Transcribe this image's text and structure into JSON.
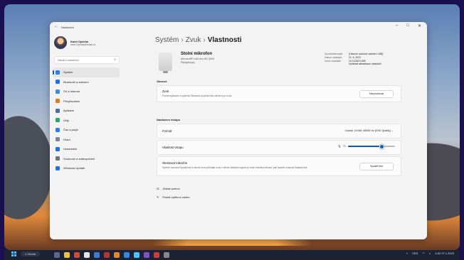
{
  "window": {
    "title": "Nastavení"
  },
  "user": {
    "name": "Karel Operka",
    "email": "karel.Operka@email.cz"
  },
  "search": {
    "placeholder": "Hledat v nastavení"
  },
  "nav": [
    {
      "label": "Systém",
      "icon": "monitor-icon",
      "color": "#2b7de9",
      "active": true
    },
    {
      "label": "Bluetooth a zařízení",
      "icon": "bluetooth-icon",
      "color": "#1a73e8"
    },
    {
      "label": "Síť a internet",
      "icon": "wifi-icon",
      "color": "#3a8ddb"
    },
    {
      "label": "Přizpůsobení",
      "icon": "brush-icon",
      "color": "#e07b1a"
    },
    {
      "label": "Aplikace",
      "icon": "apps-icon",
      "color": "#4a6fa5"
    },
    {
      "label": "Účty",
      "icon": "account-icon",
      "color": "#2aa36b"
    },
    {
      "label": "Čas a jazyk",
      "icon": "globe-icon",
      "color": "#2b7de9"
    },
    {
      "label": "Hraní",
      "icon": "gamepad-icon",
      "color": "#7b8794"
    },
    {
      "label": "Usnadnění",
      "icon": "accessibility-icon",
      "color": "#1a73e8"
    },
    {
      "label": "Soukromí a zabezpečení",
      "icon": "shield-icon",
      "color": "#6b7280"
    },
    {
      "label": "Windows Update",
      "icon": "update-icon",
      "color": "#1a73e8"
    }
  ],
  "breadcrumb": {
    "part1": "Systém",
    "part2": "Zvuk",
    "current": "Vlastnosti",
    "sep": "›"
  },
  "device": {
    "name": "Stolní mikrofon",
    "model": "Microsoft® LifeCam HD-3000",
    "status": "Připojeno(a)"
  },
  "properties": [
    {
      "k": "Zprostředkovatel",
      "v": "(Obecné zvukové zařízení USB)"
    },
    {
      "k": "Datum ovladače",
      "v": "21. 6. 2022"
    },
    {
      "k": "Verze ovladače",
      "v": "10.0.22621.608"
    },
    {
      "k": "",
      "v": "Vyhledat aktualizace ovladačů"
    }
  ],
  "general": {
    "section": "Obecné",
    "title": "Zvuk",
    "desc": "Povolit aplikacím a systému Windows používat toto zařízení pro zvuk",
    "button": "Nepovolovat"
  },
  "input": {
    "section": "Nastavení vstupu",
    "format_label": "Formát",
    "format_value": "1 kanál, 16 bitů, 48000 Hz (DVD Quality)",
    "volume_label": "Hlasitost vstupu",
    "volume_value": "71",
    "volume_fraction": 0.71,
    "test_title": "Otestovat mikrofon",
    "test_desc": "Vyberte možnost Spustit test a mluvte nebo přehrajte zvuk v běžné hlasitosti zapsat po dobu několika sekund, pak vyberte možnost Zastavit test.",
    "test_button": "Spustit test"
  },
  "links": [
    {
      "label": "Získat pomoc",
      "icon": "help-icon"
    },
    {
      "label": "Poslat zpětnou vazbu",
      "icon": "feedback-icon"
    }
  ],
  "taskbar": {
    "search": "Hledat",
    "time": "1:02",
    "date": "27.1.2023",
    "lang": "CES"
  }
}
